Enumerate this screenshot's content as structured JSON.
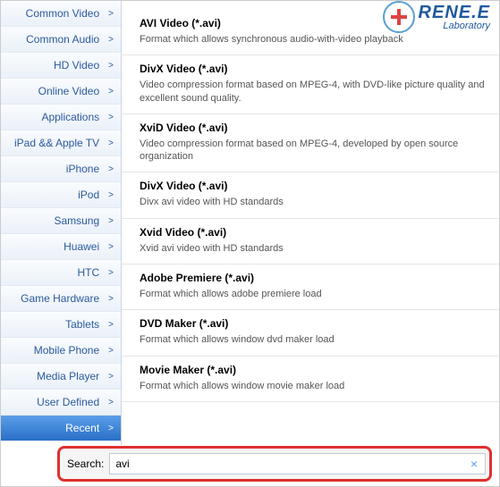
{
  "logo": {
    "brand": "RENE.E",
    "sub": "Laboratory"
  },
  "sidebar": {
    "items": [
      {
        "label": "Common Video",
        "active": false
      },
      {
        "label": "Common Audio",
        "active": false
      },
      {
        "label": "HD Video",
        "active": false
      },
      {
        "label": "Online Video",
        "active": false
      },
      {
        "label": "Applications",
        "active": false
      },
      {
        "label": "iPad && Apple TV",
        "active": false
      },
      {
        "label": "iPhone",
        "active": false
      },
      {
        "label": "iPod",
        "active": false
      },
      {
        "label": "Samsung",
        "active": false
      },
      {
        "label": "Huawei",
        "active": false
      },
      {
        "label": "HTC",
        "active": false
      },
      {
        "label": "Game Hardware",
        "active": false
      },
      {
        "label": "Tablets",
        "active": false
      },
      {
        "label": "Mobile Phone",
        "active": false
      },
      {
        "label": "Media Player",
        "active": false
      },
      {
        "label": "User Defined",
        "active": false
      },
      {
        "label": "Recent",
        "active": true
      }
    ]
  },
  "formats": [
    {
      "title": "AVI Video (*.avi)",
      "desc": "Format which allows synchronous audio-with-video playback"
    },
    {
      "title": "DivX Video (*.avi)",
      "desc": "Video compression format based on MPEG-4, with DVD-like picture quality and excellent sound quality."
    },
    {
      "title": "XviD Video (*.avi)",
      "desc": "Video compression format based on MPEG-4, developed by open source organization"
    },
    {
      "title": "DivX Video (*.avi)",
      "desc": "Divx avi video with HD standards"
    },
    {
      "title": "Xvid Video (*.avi)",
      "desc": "Xvid avi video with HD standards"
    },
    {
      "title": "Adobe Premiere (*.avi)",
      "desc": "Format which allows adobe premiere load"
    },
    {
      "title": "DVD Maker (*.avi)",
      "desc": "Format which allows window dvd maker load"
    },
    {
      "title": "Movie Maker (*.avi)",
      "desc": "Format which allows window movie maker load"
    }
  ],
  "search": {
    "label": "Search:",
    "value": "avi",
    "clear": "×"
  }
}
